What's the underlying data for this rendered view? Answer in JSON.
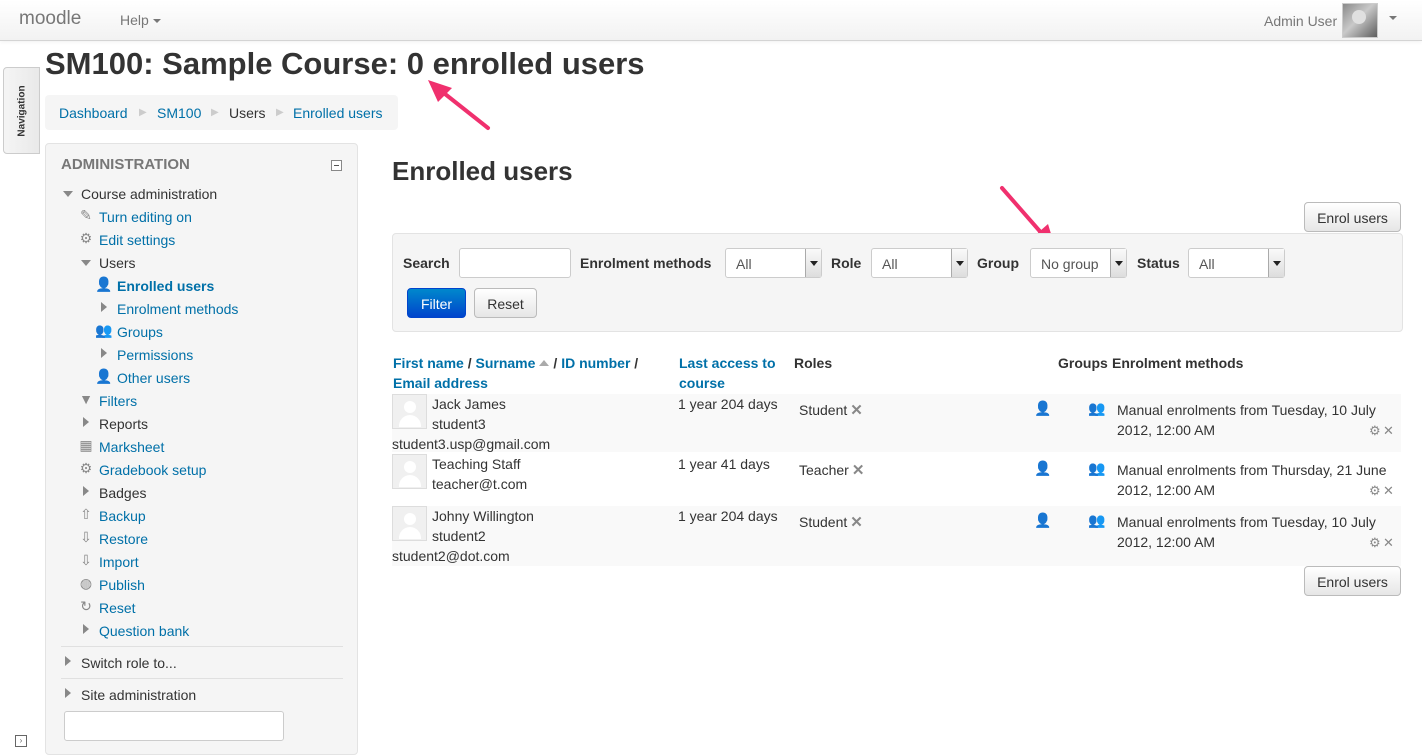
{
  "navbar": {
    "brand": "moodle",
    "help": "Help",
    "user_name": "Admin User"
  },
  "nav_tab": "Navigation",
  "page_header": "SM100: Sample Course: 0 enrolled users",
  "breadcrumb": [
    "Dashboard",
    "SM100",
    "Users",
    "Enrolled users"
  ],
  "admin": {
    "title": "ADMINISTRATION",
    "course_admin": "Course administration",
    "items": {
      "turn_editing": "Turn editing on",
      "edit_settings": "Edit settings",
      "users": "Users",
      "enrolled_users": "Enrolled users",
      "enrolment_methods": "Enrolment methods",
      "groups": "Groups",
      "permissions": "Permissions",
      "other_users": "Other users",
      "filters": "Filters",
      "reports": "Reports",
      "marksheet": "Marksheet",
      "gradebook_setup": "Gradebook setup",
      "badges": "Badges",
      "backup": "Backup",
      "restore": "Restore",
      "import": "Import",
      "publish": "Publish",
      "reset": "Reset",
      "question_bank": "Question bank"
    },
    "switch_role": "Switch role to...",
    "site_admin": "Site administration"
  },
  "main": {
    "title": "Enrolled users",
    "enrol_button": "Enrol users",
    "filters": {
      "search_label": "Search",
      "search_value": "",
      "enrolment_label": "Enrolment methods",
      "enrolment_value": "All",
      "role_label": "Role",
      "role_value": "All",
      "group_label": "Group",
      "group_value": "No group",
      "status_label": "Status",
      "status_value": "All",
      "filter_button": "Filter",
      "reset_button": "Reset"
    },
    "columns": {
      "first_name": "First name",
      "surname": "Surname",
      "id_number": "ID number",
      "email": "Email address",
      "last_access": "Last access to course",
      "roles": "Roles",
      "groups": "Groups",
      "enrolment_methods": "Enrolment methods"
    },
    "rows": [
      {
        "name": "Jack James",
        "id": "student3",
        "email": "student3.usp@gmail.com",
        "last_access": "1 year 204 days",
        "role": "Student",
        "enrolment_line1": "Manual enrolments from Tuesday, 10 July",
        "enrolment_line2": "2012, 12:00 AM"
      },
      {
        "name": "Teaching Staff",
        "id": "teacher@t.com",
        "email": "",
        "last_access": "1 year 41 days",
        "role": "Teacher",
        "enrolment_line1": "Manual enrolments from Thursday, 21 June",
        "enrolment_line2": "2012, 12:00 AM"
      },
      {
        "name": "Johny Willington",
        "id": "student2",
        "email": "student2@dot.com",
        "last_access": "1 year 204 days",
        "role": "Student",
        "enrolment_line1": "Manual enrolments from Tuesday, 10 July",
        "enrolment_line2": "2012, 12:00 AM"
      }
    ]
  },
  "colors": {
    "link": "#0070a8",
    "primary_button": "#0044cc",
    "annotation_arrow": "#f0306e"
  },
  "icons": [
    "pencil-icon",
    "gear-icon",
    "user-add-icon",
    "users-icon",
    "filter-icon",
    "table-icon",
    "upload-icon",
    "download-icon",
    "globe-icon",
    "refresh-icon",
    "remove-icon",
    "collapse-icon",
    "dock-icon"
  ]
}
